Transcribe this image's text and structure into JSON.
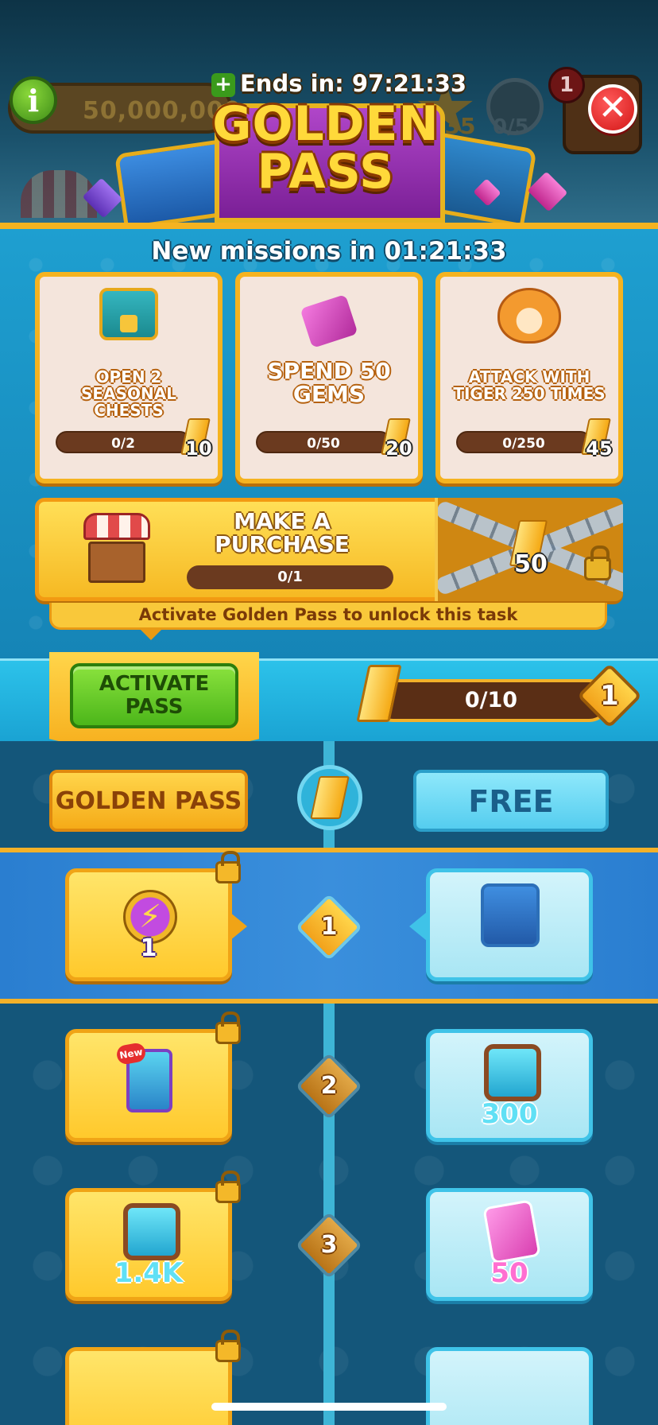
{
  "hud": {
    "coins": "50,000,000",
    "stars": "335",
    "shields": "0/5",
    "notification_count": "1",
    "info_glyph": "i"
  },
  "header": {
    "plus_glyph": "+",
    "ends_in": "Ends in: 97:21:33",
    "title_line1": "GOLDEN",
    "title_line2": "PASS",
    "close_glyph": "✕"
  },
  "missions": {
    "refresh_text": "New missions in 01:21:33",
    "items": [
      {
        "label": "OPEN 2 SEASONAL CHESTS",
        "progress": "0/2",
        "reward": "10",
        "icon": "seasonal-chest-icon"
      },
      {
        "label": "SPEND 50 GEMS",
        "progress": "0/50",
        "reward": "20",
        "icon": "gems-icon"
      },
      {
        "label": "ATTACK WITH TIGER 250 TIMES",
        "progress": "0/250",
        "reward": "45",
        "icon": "tiger-icon"
      }
    ],
    "purchase": {
      "label": "MAKE A PURCHASE",
      "progress": "0/1",
      "reward": "50",
      "locked_note": "Activate Golden Pass to unlock this task"
    }
  },
  "pass": {
    "activate_label_line1": "ACTIVATE",
    "activate_label_line2": "PASS",
    "level_progress": "0/10",
    "level_progress_fraction": 0,
    "current_level": "1",
    "golden_header": "GOLDEN PASS",
    "free_header": "FREE"
  },
  "tiers": [
    {
      "level": "1",
      "golden": {
        "icon": "energy-icon",
        "amount": "1"
      },
      "free": {
        "icon": "chest-icon",
        "amount": ""
      }
    },
    {
      "level": "2",
      "golden": {
        "icon": "new-card-icon",
        "amount": "",
        "badge": "New"
      },
      "free": {
        "icon": "spins-icon",
        "amount": "300"
      }
    },
    {
      "level": "3",
      "golden": {
        "icon": "spins-icon",
        "amount": "1.4K"
      },
      "free": {
        "icon": "gem-icon",
        "amount": "50"
      }
    }
  ],
  "colors": {
    "gold": "#f5b320",
    "sky": "#1e9fd0",
    "track": "#14567a",
    "green_button": "#4cb61a",
    "close_red": "#d31616"
  }
}
